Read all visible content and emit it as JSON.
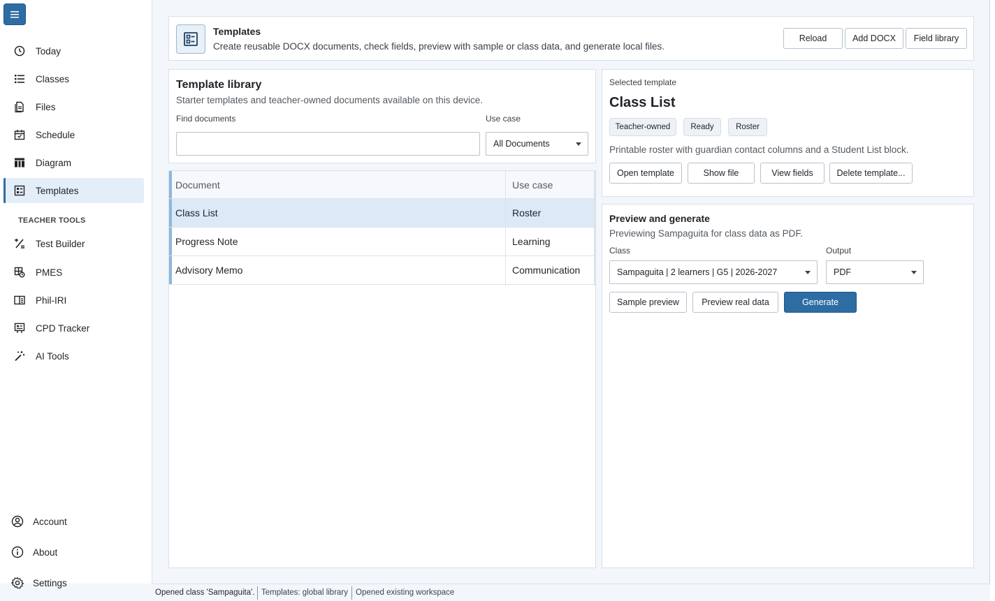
{
  "sidebar": {
    "items": [
      {
        "label": "Today",
        "icon": "clock-icon"
      },
      {
        "label": "Classes",
        "icon": "list-icon"
      },
      {
        "label": "Files",
        "icon": "file-icon"
      },
      {
        "label": "Schedule",
        "icon": "calendar-icon"
      },
      {
        "label": "Diagram",
        "icon": "diagram-icon"
      },
      {
        "label": "Templates",
        "icon": "template-icon",
        "active": true
      }
    ],
    "section_label": "TEACHER TOOLS",
    "tools": [
      {
        "label": "Test Builder",
        "icon": "percent-icon"
      },
      {
        "label": "PMES",
        "icon": "grid-icon"
      },
      {
        "label": "Phil-IRI",
        "icon": "book-icon"
      },
      {
        "label": "CPD Tracker",
        "icon": "tracker-icon"
      },
      {
        "label": "AI Tools",
        "icon": "wand-icon"
      }
    ],
    "bottom": [
      {
        "label": "Account",
        "icon": "user-icon"
      },
      {
        "label": "About",
        "icon": "info-icon"
      },
      {
        "label": "Settings",
        "icon": "gear-icon"
      }
    ]
  },
  "header": {
    "title": "Templates",
    "subtitle": "Create reusable DOCX documents, check fields, preview with sample or class data, and generate local files.",
    "reload_label": "Reload",
    "add_docx_label": "Add DOCX",
    "field_library_label": "Field library"
  },
  "library": {
    "title": "Template library",
    "subtitle": "Starter templates and teacher-owned documents available on this device.",
    "find_label": "Find documents",
    "find_value": "",
    "use_case_label": "Use case",
    "use_case_value": "All Documents"
  },
  "table": {
    "columns": [
      "Document",
      "Use case"
    ],
    "rows": [
      {
        "document": "Class List",
        "use_case": "Roster",
        "selected": true
      },
      {
        "document": "Progress Note",
        "use_case": "Learning"
      },
      {
        "document": "Advisory Memo",
        "use_case": "Communication"
      }
    ]
  },
  "selected": {
    "label": "Selected template",
    "title": "Class List",
    "badges": [
      "Teacher-owned",
      "Ready",
      "Roster"
    ],
    "description": "Printable roster with guardian contact columns and a Student List block.",
    "open_label": "Open template",
    "show_file_label": "Show file",
    "view_fields_label": "View fields",
    "delete_label": "Delete template..."
  },
  "generate": {
    "title": "Preview and generate",
    "subtitle": "Previewing Sampaguita for class data as PDF.",
    "class_label": "Class",
    "class_value": "Sampaguita | 2 learners | G5 | 2026-2027",
    "output_label": "Output",
    "output_value": "PDF",
    "sample_label": "Sample preview",
    "real_label": "Preview real data",
    "generate_label": "Generate"
  },
  "status": {
    "seg1": "Opened class 'Sampaguita'.",
    "seg2": "Templates: global library",
    "seg3": "Opened existing workspace"
  },
  "colors": {
    "accent": "#2e6da4",
    "selected_row": "#dce9f7",
    "row_accent": "#8db7df"
  }
}
